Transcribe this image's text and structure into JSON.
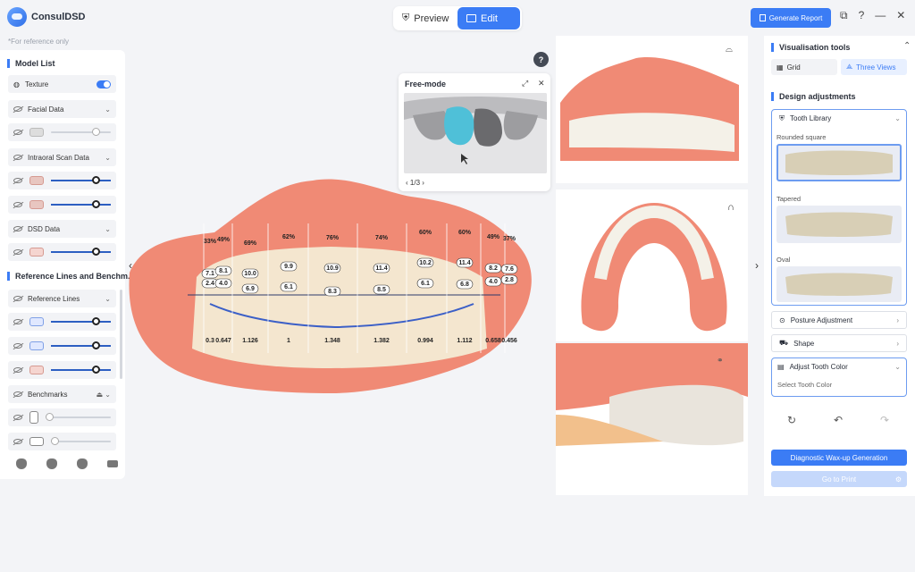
{
  "app": {
    "name": "ConsulDSD",
    "reference_note": "*For reference only"
  },
  "mode": {
    "preview_label": "Preview",
    "edit_label": "Edit"
  },
  "header": {
    "generate_report_label": "Generate Report"
  },
  "left_panel": {
    "model_list_title": "Model List",
    "texture_label": "Texture",
    "texture_on": true,
    "facial_data_label": "Facial Data",
    "intraoral_label": "Intraoral Scan Data",
    "dsd_label": "DSD Data",
    "reference_section_title": "Reference Lines and Benchm...",
    "reference_lines_label": "Reference Lines",
    "benchmarks_label": "Benchmarks",
    "sliders": {
      "facial": 1.0,
      "intraoral_1": 1.0,
      "intraoral_2": 1.0,
      "dsd": 1.0,
      "ref_1": 1.0,
      "ref_2": 1.0,
      "ref_3": 1.0,
      "bench_1": 0.0,
      "bench_2": 0.0
    }
  },
  "free_mode": {
    "title": "Free-mode",
    "pager": "1/3"
  },
  "measurements": {
    "percents": [
      "33%",
      "49%",
      "69%",
      "62%",
      "76%",
      "74%",
      "60%",
      "60%",
      "49%",
      "37%"
    ],
    "upper_labels": [
      "7.1",
      "8.1",
      "10.0",
      "9.9",
      "10.9",
      "11.4",
      "10.2",
      "11.4",
      "8.2",
      "7.6"
    ],
    "mid_labels": [
      "2.4",
      "4.0",
      "6.9",
      "6.1",
      "8.3",
      "8.5",
      "6.1",
      "6.8",
      "4.0",
      "2.8"
    ],
    "ratios": [
      "0.3",
      "0.647",
      "1.126",
      "1",
      "1.348",
      "1.382",
      "0.994",
      "1.112",
      "0.658",
      "0.456"
    ]
  },
  "right_panel": {
    "vis_tools_title": "Visualisation tools",
    "grid_label": "Grid",
    "three_views_label": "Three Views",
    "design_title": "Design adjustments",
    "tooth_library_label": "Tooth Library",
    "library_items": [
      "Rounded square",
      "Tapered",
      "Oval"
    ],
    "posture_label": "Posture Adjustment",
    "shape_label": "Shape",
    "color_label": "Adjust Tooth Color",
    "select_color_label": "Select Tooth Color",
    "waxup_label": "Diagnostic Wax-up Generation",
    "print_label": "Go to Print"
  },
  "colors": {
    "accent": "#3b7cf5",
    "gum": "#f08a75",
    "tooth": "#f4f0e6"
  }
}
